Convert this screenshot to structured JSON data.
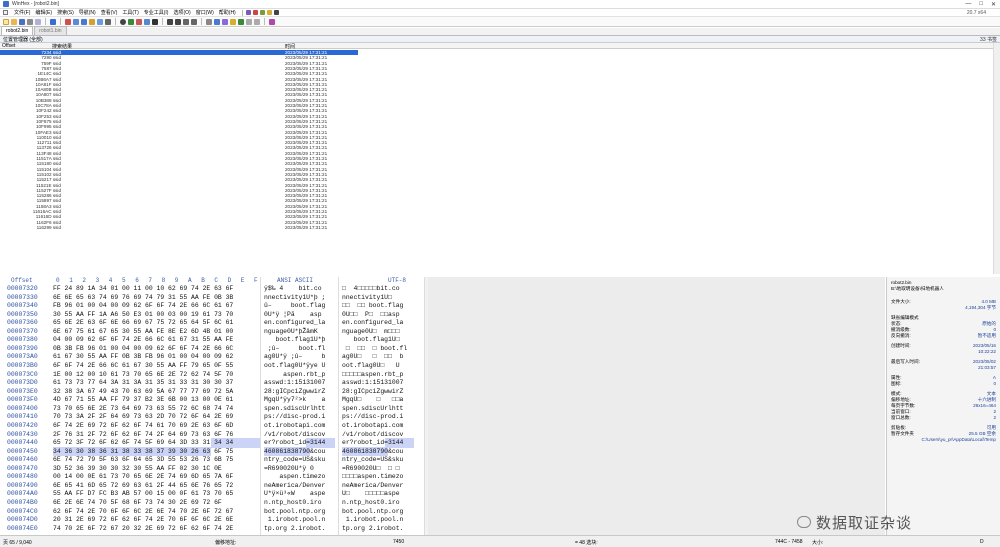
{
  "window": {
    "title": "WinHex - [robot2.bin]",
    "version": "20.7 x64",
    "controls": [
      "—",
      "□",
      "✕"
    ]
  },
  "menu": {
    "items": [
      "文件(F)",
      "编辑(E)",
      "搜索(S)",
      "导航(N)",
      "查看(V)",
      "工具(T)",
      "专业工具(I)",
      "选项(O)",
      "窗口(W)",
      "帮助(H)"
    ]
  },
  "tabs": [
    {
      "label": "robot2.bin",
      "active": true
    },
    {
      "label": "robot1.bin",
      "active": false
    }
  ],
  "pane_header": {
    "left": "位置管理器 (全部)",
    "right": "33 书签"
  },
  "list": {
    "col_offset": "Offset",
    "col_desc": "搜索结果",
    "col_time": "时间",
    "rows": [
      {
        "offset": "7234 ssid",
        "time": "2023/05/29  17:31:21",
        "selected": true
      },
      {
        "offset": "7290 ssid",
        "time": "2023/05/29  17:31:21"
      },
      {
        "offset": "759F ssid",
        "time": "2023/05/29  17:31:21"
      },
      {
        "offset": "7587 ssid",
        "time": "2023/05/29  17:31:21"
      },
      {
        "offset": "1E14C ssid",
        "time": "2023/05/29  17:31:21"
      },
      {
        "offset": "10B6A7 ssid",
        "time": "2023/05/29  17:31:21"
      },
      {
        "offset": "10A81F ssid",
        "time": "2023/05/29  17:31:21"
      },
      {
        "offset": "10A80B ssid",
        "time": "2023/05/29  17:31:21"
      },
      {
        "offset": "10A807 ssid",
        "time": "2023/05/29  17:31:21"
      },
      {
        "offset": "10B388 ssid",
        "time": "2023/05/29  17:31:21"
      },
      {
        "offset": "10C78A ssid",
        "time": "2023/05/29  17:31:21"
      },
      {
        "offset": "10F242 ssid",
        "time": "2023/05/29  17:31:21"
      },
      {
        "offset": "10F253 ssid",
        "time": "2023/05/29  17:31:21"
      },
      {
        "offset": "10F875 ssid",
        "time": "2023/05/29  17:31:21"
      },
      {
        "offset": "10F995 ssid",
        "time": "2023/05/29  17:31:21"
      },
      {
        "offset": "10FAE3 ssid",
        "time": "2023/05/29  17:31:21"
      },
      {
        "offset": "110010 ssid",
        "time": "2023/05/29  17:31:21"
      },
      {
        "offset": "112711 ssid",
        "time": "2023/05/29  17:31:21"
      },
      {
        "offset": "113726 ssid",
        "time": "2023/05/29  17:31:21"
      },
      {
        "offset": "113F48 ssid",
        "time": "2023/05/29  17:31:21"
      },
      {
        "offset": "11517A ssid",
        "time": "2023/05/29  17:31:21"
      },
      {
        "offset": "115180 ssid",
        "time": "2023/05/29  17:31:21"
      },
      {
        "offset": "115104 ssid",
        "time": "2023/05/29  17:31:21"
      },
      {
        "offset": "115102 ssid",
        "time": "2023/05/29  17:31:21"
      },
      {
        "offset": "115217 ssid",
        "time": "2023/05/29  17:31:21"
      },
      {
        "offset": "11521E ssid",
        "time": "2023/05/29  17:31:21"
      },
      {
        "offset": "11527F ssid",
        "time": "2023/05/29  17:31:21"
      },
      {
        "offset": "115286 ssid",
        "time": "2023/05/29  17:31:21"
      },
      {
        "offset": "115897 ssid",
        "time": "2023/05/29  17:31:21"
      },
      {
        "offset": "1158A3 ssid",
        "time": "2023/05/29  17:31:21"
      },
      {
        "offset": "11616AC ssid",
        "time": "2023/05/29  17:31:21"
      },
      {
        "offset": "11616D ssid",
        "time": "2023/05/29  17:31:21"
      },
      {
        "offset": "1162F6 ssid",
        "time": "2023/05/29  17:31:21"
      },
      {
        "offset": "116299 ssid",
        "time": "2023/05/29  17:31:21"
      }
    ]
  },
  "hex": {
    "header_offset": "Offset",
    "header_cols": [
      "0",
      "1",
      "2",
      "3",
      "4",
      "5",
      "6",
      "7",
      "8",
      "9",
      "A",
      "B",
      "C",
      "D",
      "E",
      "F"
    ],
    "header_ansi": "ANSI ASCII",
    "header_utf": "UTF-8",
    "rows": [
      {
        "o": "00007320",
        "h": "FF 24 89 1A 34 01 00 11 00 10 62 69 74 2E 63 6F",
        "a": "ÿ$‰ 4    bit.co",
        "u": "□  4□□□□□bit.co"
      },
      {
        "o": "00007330",
        "h": "6E 6E 65 63 74 69 76 69 74 79 31 55 AA FE 0B 3B",
        "a": "nnectivity1U*þ ;",
        "u": "nnectivity1U□"
      },
      {
        "o": "00007340",
        "h": "FB 96 01 00 04 00 09 62 6F 6F 74 2E 66 6C 61 67",
        "a": "û–     boot.flag",
        "u": "□□  □□ boot.flag"
      },
      {
        "o": "00007350",
        "h": "30 55 AA FF 1A A6 50 E3 01 00 03 00 19 61 73 70",
        "a": "0U*ÿ ¦Pã    asp",
        "u": "0U□□  P□  □□asp"
      },
      {
        "o": "00007360",
        "h": "65 6E 2E 63 6F 6E 66 69 67 75 72 65 64 5F 6C 61",
        "a": "en.configured_la",
        "u": "en.configured_la"
      },
      {
        "o": "00007370",
        "h": "6E 67 75 61 67 65 30 55 AA FE 8E E2 6D 4B 01 00",
        "a": "nguage0U*þŽâmK",
        "u": "nguage0U□  m□□□"
      },
      {
        "o": "00007380",
        "h": "04 00 09 62 6F 6F 74 2E 66 6C 61 67 31 55 AA FE",
        "a": "   boot.flag1U*þ",
        "u": "   boot.flag1U□"
      },
      {
        "o": "00007390",
        "h": "0B 3B FB 96 01 00 04 00 09 62 6F 6F 74 2E 66 6C",
        "a": " ;û–     boot.fl",
        "u": " □  □□  □ boot.fl"
      },
      {
        "o": "000073A0",
        "h": "61 67 30 55 AA FF 0B 3B FB 96 01 00 04 00 09 62",
        "a": "ag0U*ÿ ;û–     b",
        "u": "ag0U□   □  □□  b"
      },
      {
        "o": "000073B0",
        "h": "6F 6F 74 2E 66 6C 61 67 30 55 AA FF 79 65 0F 55",
        "a": "oot.flag0U*ÿye U",
        "u": "oot.flag0U□   U"
      },
      {
        "o": "000073C0",
        "h": "1E 00 12 00 10 61 73 70 65 6E 2E 72 62 74 5F 70",
        "a": "     aspen.rbt_p",
        "u": "□□□□□aspen.rbt_p"
      },
      {
        "o": "000073D0",
        "h": "61 73 73 77 64 3A 31 3A 31 35 31 33 31 30 30 37",
        "a": "asswd:1:15131007",
        "u": "asswd:1:15131007"
      },
      {
        "o": "000073E0",
        "h": "32 38 3A 67 49 43 70 63 69 5A 67 77 77 69 72 5A",
        "a": "28:gICpciZgwwirZ",
        "u": "28:gICpciZgwwirZ"
      },
      {
        "o": "000073F0",
        "h": "4D 67 71 55 AA FF 79 37 B2 3E 6B 00 13 00 0E 61",
        "a": "MgqU*ÿy7²>k    a",
        "u": "MgqU□    □   □□a"
      },
      {
        "o": "00007400",
        "h": "73 70 65 6E 2E 73 64 69 73 63 55 72 6C 68 74 74",
        "a": "spen.sdiscUrlhtt",
        "u": "spen.sdiscUrlhtt"
      },
      {
        "o": "00007410",
        "h": "70 73 3A 2F 2F 64 69 73 63 2D 70 72 6F 64 2E 69",
        "a": "ps://disc-prod.i",
        "u": "ps://disc-prod.i"
      },
      {
        "o": "00007420",
        "h": "6F 74 2E 69 72 6F 62 6F 74 61 70 69 2E 63 6F 6D",
        "a": "ot.irobotapi.com",
        "u": "ot.irobotapi.com"
      },
      {
        "o": "00007430",
        "h": "2F 76 31 2F 72 6F 62 6F 74 2F 64 69 73 63 6F 76",
        "a": "/v1/robot/discov",
        "u": "/v1/robot/discov"
      },
      {
        "o": "00007440",
        "h": "65 72 3F 72 6F 62 6F 74 5F 69 64 3D 33 31 34 34",
        "a": "er?robot_id=3144",
        "u": "er?robot_id=3144"
      },
      {
        "o": "00007450",
        "h": "34 36 30 38 36 31 38 33 38 37 39 30 26 63 6F 75",
        "a": "460861838790&cou",
        "u": "460861838790&cou"
      },
      {
        "o": "00007460",
        "h": "6E 74 72 79 5F 63 6F 64 65 3D 55 53 26 73 6B 75",
        "a": "ntry_code=US&sku",
        "u": "ntry_code=US&sku"
      },
      {
        "o": "00007470",
        "h": "3D 52 36 39 30 30 32 30 55 AA FF 02 30 1C 0E",
        "a": "=R690020U*ÿ 0",
        "u": "=R690020U□  □ □"
      },
      {
        "o": "00007480",
        "h": "00 14 00 0E 61 73 70 65 6E 2E 74 69 6D 65 7A 6F",
        "a": "    aspen.timezo",
        "u": "□□□□aspen.timezo"
      },
      {
        "o": "00007490",
        "h": "6E 65 41 6D 65 72 69 63 61 2F 44 65 6E 76 65 72",
        "a": "neAmerica/Denver",
        "u": "neAmerica/Denver"
      },
      {
        "o": "000074A0",
        "h": "55 AA FF D7 FC B3 AB 57 00 15 00 0F 61 73 70 65",
        "a": "U*ÿ×ü³«W    aspe",
        "u": "U□    □□□□□aspe"
      },
      {
        "o": "000074B0",
        "h": "6E 2E 6E 74 70 5F 68 6F 73 74 30 2E 69 72 6F",
        "a": "n.ntp_host0.iro",
        "u": "n.ntp_host0.iro"
      },
      {
        "o": "000074C0",
        "h": "62 6F 74 2E 70 6F 6F 6C 2E 6E 74 70 2E 6F 72 67",
        "a": "bot.pool.ntp.org",
        "u": "bot.pool.ntp.org"
      },
      {
        "o": "000074D0",
        "h": "20 31 2E 69 72 6F 62 6F 74 2E 70 6F 6F 6C 2E 6E",
        "a": " 1.irobot.pool.n",
        "u": " 1.irobot.pool.n"
      },
      {
        "o": "000074E0",
        "h": "74 70 2E 6F 72 67 20 32 2E 69 72 6F 62 6F 74 2E",
        "a": "tp.org 2.irobot.",
        "u": "tp.org 2.irobot."
      }
    ]
  },
  "info": {
    "file": "robot2.bin",
    "path": "B:\\地取明设备\\扫地机器人",
    "rows": [
      {
        "k": "文件大小:",
        "v": "4.0 MB"
      },
      {
        "k": "",
        "v": "4,194,304 字节"
      },
      {
        "k": "缺省编辑模式",
        "v": ""
      },
      {
        "k": "状态:",
        "v": "原始的"
      },
      {
        "k": "撤消级数:",
        "v": "0"
      },
      {
        "k": "反向撤消:",
        "v": "暂不适用"
      },
      {
        "k": "创建时间:",
        "v": "2023/05/16"
      },
      {
        "k": "",
        "v": "10:22:22"
      },
      {
        "k": "最后写入时间:",
        "v": "2023/05/02"
      },
      {
        "k": "",
        "v": "21:03:57"
      },
      {
        "k": "属性:",
        "v": "A"
      },
      {
        "k": "图标:",
        "v": "0"
      },
      {
        "k": "模式:",
        "v": "文本"
      },
      {
        "k": "偏移地址:",
        "v": "十六进制"
      },
      {
        "k": "每页字节数:",
        "v": "29x16=464"
      },
      {
        "k": "当前窗口:",
        "v": "2"
      },
      {
        "k": "窗口总数:",
        "v": "2"
      },
      {
        "k": "剪贴板:",
        "v": "可用"
      },
      {
        "k": "暂存文件夹",
        "v": "25.5 GB 空余"
      },
      {
        "k": "",
        "v": "C:\\Users\\yu_pr\\AppData\\Local\\Temp"
      }
    ]
  },
  "status": {
    "page": "页 65 / 9,040",
    "offset_label": "偏移地址:",
    "offset_val": "7450",
    "sel_label": "= 48  选块:",
    "sel_range": "744C - 7458",
    "size_label": "大小:",
    "size_val": "D"
  },
  "watermark": "数据取证杂谈"
}
